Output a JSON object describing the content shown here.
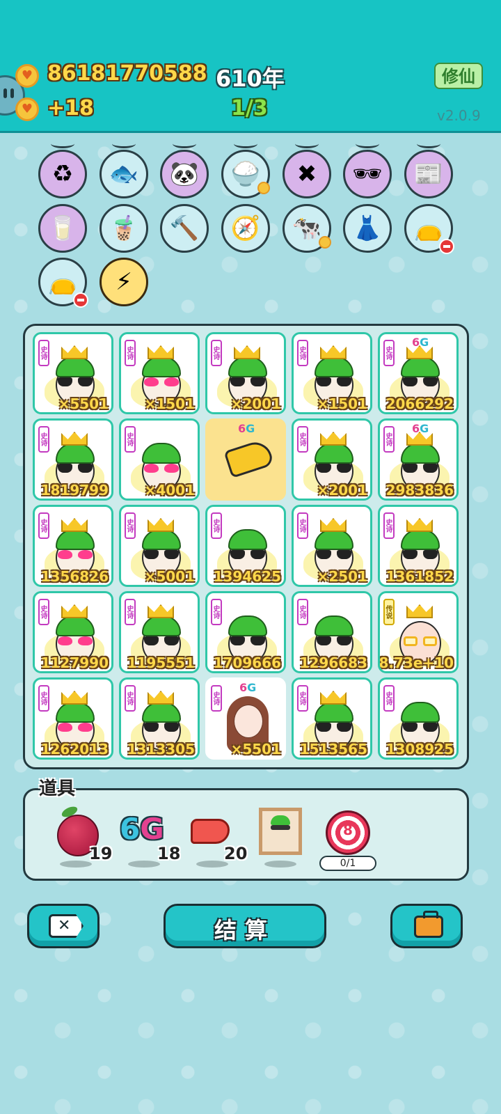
{
  "header": {
    "gold": "86181770588",
    "rate": "+18",
    "year": "610年",
    "stage": "1/3",
    "cultivate_label": "修仙",
    "version": "v2.0.9"
  },
  "items": [
    {
      "icon": "recycle-icon",
      "glyph": "♻"
    },
    {
      "icon": "fishbowl-icon",
      "glyph": "🐟"
    },
    {
      "icon": "panda-icon",
      "glyph": "🐼"
    },
    {
      "icon": "rice-bowl-icon",
      "glyph": "🍚"
    },
    {
      "icon": "math-formula-icon",
      "glyph": "✖"
    },
    {
      "icon": "sunglasses-icon",
      "glyph": "🕶"
    },
    {
      "icon": "time-magazine-icon",
      "glyph": "📰"
    },
    {
      "icon": "milk-jar-icon",
      "glyph": "🥛"
    },
    {
      "icon": "bubble-tea-icon",
      "glyph": "🧋"
    },
    {
      "icon": "hammer-icon",
      "glyph": "🔨"
    },
    {
      "icon": "compass-icon",
      "glyph": "🧭"
    },
    {
      "icon": "cows-icon",
      "glyph": "🐄"
    },
    {
      "icon": "skirt-icon",
      "glyph": "👗"
    },
    {
      "icon": "sack-icon",
      "glyph": "👝"
    },
    {
      "icon": "sack-icon",
      "glyph": "👝"
    },
    {
      "icon": "lightning-icon",
      "glyph": "⚡"
    }
  ],
  "board": {
    "tag_epic": "史诗",
    "tag_legend": "传说",
    "cells": [
      {
        "num": "×5501",
        "crown": true,
        "heart": false,
        "g6": false,
        "kind": "man"
      },
      {
        "num": "×1501",
        "crown": true,
        "heart": true,
        "g6": false,
        "kind": "man"
      },
      {
        "num": "×2001",
        "crown": true,
        "heart": false,
        "g6": false,
        "kind": "man"
      },
      {
        "num": "×1501",
        "crown": true,
        "heart": false,
        "g6": false,
        "kind": "man"
      },
      {
        "num": "2066292",
        "crown": true,
        "heart": false,
        "g6": true,
        "kind": "man"
      },
      {
        "num": "1819799",
        "crown": true,
        "heart": false,
        "g6": false,
        "kind": "man"
      },
      {
        "num": "×4001",
        "crown": false,
        "heart": true,
        "g6": false,
        "kind": "man"
      },
      {
        "num": "",
        "crown": false,
        "heart": false,
        "g6": true,
        "kind": "hand"
      },
      {
        "num": "×2001",
        "crown": true,
        "heart": false,
        "g6": false,
        "kind": "man"
      },
      {
        "num": "2983836",
        "crown": true,
        "heart": false,
        "g6": true,
        "kind": "man"
      },
      {
        "num": "1356826",
        "crown": true,
        "heart": true,
        "g6": false,
        "kind": "man"
      },
      {
        "num": "×5001",
        "crown": true,
        "heart": false,
        "g6": false,
        "kind": "man"
      },
      {
        "num": "1394625",
        "crown": false,
        "heart": false,
        "g6": false,
        "kind": "man"
      },
      {
        "num": "×2501",
        "crown": true,
        "heart": false,
        "g6": false,
        "kind": "man"
      },
      {
        "num": "1361852",
        "crown": true,
        "heart": false,
        "g6": false,
        "kind": "man"
      },
      {
        "num": "1127990",
        "crown": true,
        "heart": true,
        "g6": false,
        "kind": "man"
      },
      {
        "num": "1195551",
        "crown": true,
        "heart": false,
        "g6": false,
        "kind": "man"
      },
      {
        "num": "1709666",
        "crown": false,
        "heart": false,
        "g6": false,
        "kind": "man"
      },
      {
        "num": "1296683",
        "crown": false,
        "heart": false,
        "g6": false,
        "kind": "man"
      },
      {
        "num": "8.73e+10",
        "crown": true,
        "heart": false,
        "g6": false,
        "kind": "legend"
      },
      {
        "num": "1262013",
        "crown": true,
        "heart": true,
        "g6": false,
        "kind": "man"
      },
      {
        "num": "1313305",
        "crown": true,
        "heart": false,
        "g6": false,
        "kind": "man"
      },
      {
        "num": "×5501",
        "crown": false,
        "heart": false,
        "g6": true,
        "kind": "girl"
      },
      {
        "num": "1513565",
        "crown": true,
        "heart": false,
        "g6": false,
        "kind": "man"
      },
      {
        "num": "1308925",
        "crown": false,
        "heart": false,
        "g6": false,
        "kind": "man"
      }
    ]
  },
  "g6_label": {
    "six": "6",
    "g": "G"
  },
  "props": {
    "title": "道具",
    "lychee_count": "19",
    "g6_count": "18",
    "liver_count": "20",
    "target_num": "8",
    "target_progress": "0/1"
  },
  "buttons": {
    "close_glyph": "✕",
    "settle_label": "结算"
  },
  "colors": {
    "header_bg": "#17c4c4",
    "page_bg": "#a9dde3",
    "number_gold": "#ffd84a",
    "epic_tag": "#c33ac0",
    "cell_border": "#2fc7a8"
  }
}
